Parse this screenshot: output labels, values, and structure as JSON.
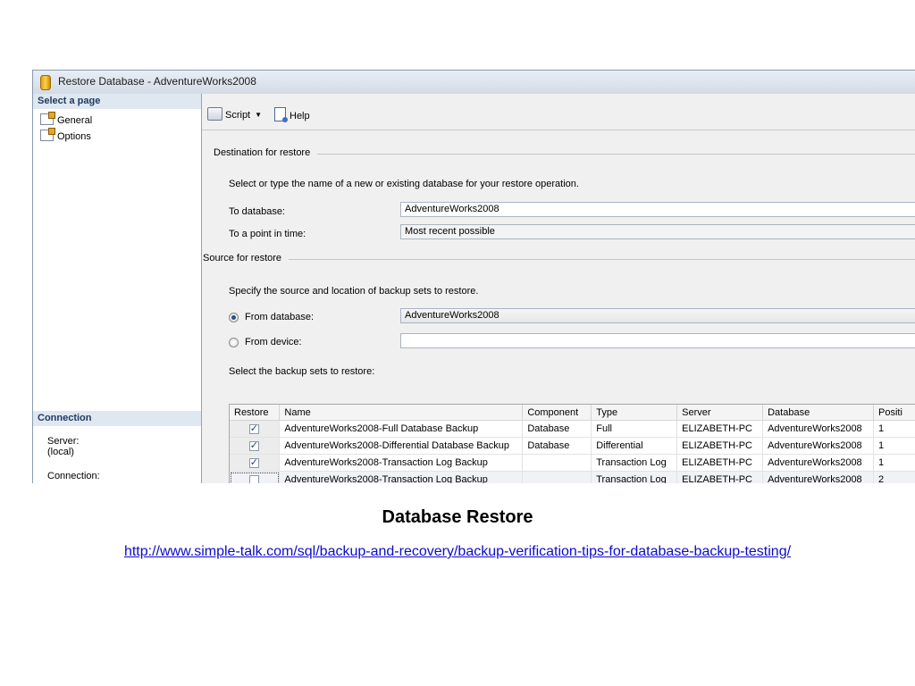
{
  "window": {
    "title": "Restore Database - AdventureWorks2008"
  },
  "left_pane": {
    "select_header": "Select a page",
    "pages": [
      {
        "label": "General"
      },
      {
        "label": "Options"
      }
    ],
    "connection_header": "Connection",
    "server_label": "Server:",
    "server_value": "(local)",
    "connection_label": "Connection:"
  },
  "toolbar": {
    "script_label": "Script",
    "help_label": "Help"
  },
  "destination": {
    "title": "Destination for restore",
    "instruction": "Select or type the name of a new or existing database for your restore operation.",
    "to_database_label": "To database:",
    "to_database_value": "AdventureWorks2008",
    "point_in_time_label": "To a point in time:",
    "point_in_time_value": "Most recent possible"
  },
  "source": {
    "title": "Source for restore",
    "instruction": "Specify the source and location of backup sets to restore.",
    "from_database_label": "From database:",
    "from_database_value": "AdventureWorks2008",
    "from_device_label": "From device:",
    "from_device_value": "",
    "selected_option": "from_database"
  },
  "backup_sets": {
    "label": "Select the backup sets to restore:",
    "columns": [
      "Restore",
      "Name",
      "Component",
      "Type",
      "Server",
      "Database",
      "Positi"
    ],
    "rows": [
      {
        "checked": true,
        "name": "AdventureWorks2008-Full Database Backup",
        "component": "Database",
        "type": "Full",
        "server": "ELIZABETH-PC",
        "database": "AdventureWorks2008",
        "position": "1"
      },
      {
        "checked": true,
        "name": "AdventureWorks2008-Differential Database Backup",
        "component": "Database",
        "type": "Differential",
        "server": "ELIZABETH-PC",
        "database": "AdventureWorks2008",
        "position": "1"
      },
      {
        "checked": true,
        "name": "AdventureWorks2008-Transaction Log  Backup",
        "component": "",
        "type": "Transaction Log",
        "server": "ELIZABETH-PC",
        "database": "AdventureWorks2008",
        "position": "1"
      },
      {
        "checked": false,
        "name": "AdventureWorks2008-Transaction Log  Backup",
        "component": "",
        "type": "Transaction Log",
        "server": "ELIZABETH-PC",
        "database": "AdventureWorks2008",
        "position": "2"
      }
    ]
  },
  "slide": {
    "caption": "Database Restore",
    "link": "http://www.simple-talk.com/sql/backup-and-recovery/backup-verification-tips-for-database-backup-testing/"
  }
}
